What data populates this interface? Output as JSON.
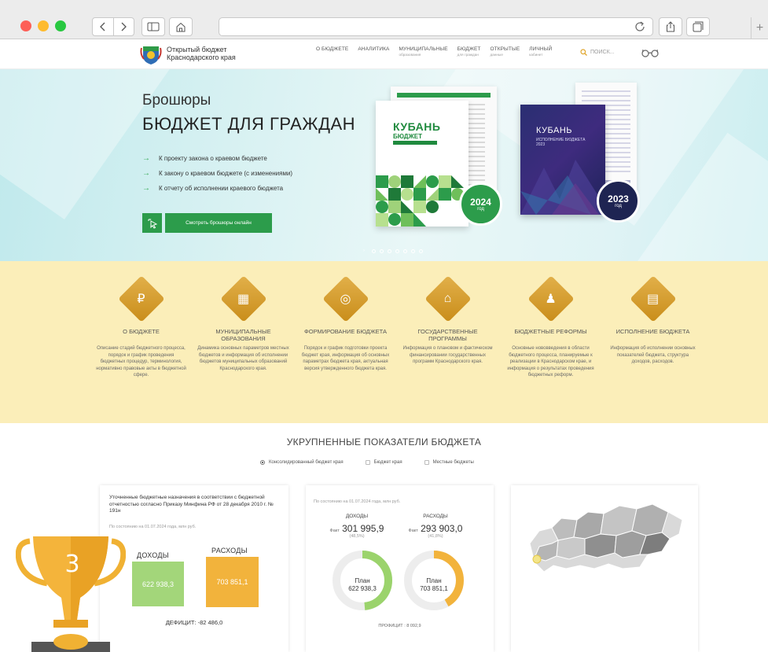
{
  "site": {
    "brand_line1": "Открытый бюджет",
    "brand_line2": "Краснодарского края",
    "nav": [
      {
        "label": "О БЮДЖЕТЕ",
        "sub": ""
      },
      {
        "label": "АНАЛИТИКА",
        "sub": ""
      },
      {
        "label": "МУНИЦИПАЛЬНЫЕ",
        "sub": "образования"
      },
      {
        "label": "БЮДЖЕТ",
        "sub": "для граждан"
      },
      {
        "label": "ОТКРЫТЫЕ",
        "sub": "данные"
      },
      {
        "label": "ЛИЧНЫЙ",
        "sub": "кабинет"
      }
    ],
    "search_placeholder": "ПОИСК..."
  },
  "hero": {
    "subtitle": "Брошюры",
    "title": "БЮДЖЕТ ДЛЯ ГРАЖДАН",
    "links": [
      "К проекту закона о краевом бюджете",
      "К закону о краевом бюджете (с изменениями)",
      "К отчету об исполнении краевого бюджета"
    ],
    "cta_label": "Смотреть брошюры онлайн",
    "brochure_2024": {
      "title": "КУБАНЬ",
      "subtitle": "БЮДЖЕТ",
      "year": "2024",
      "year_word": "год"
    },
    "brochure_2023": {
      "title": "КУБАНЬ",
      "subtitle": "ИСПОЛНЕНИЕ БЮДЖЕТА 2023",
      "year": "2023",
      "year_word": "год"
    }
  },
  "features": [
    {
      "icon": "money-bag-icon",
      "glyph": "₽",
      "title": "О БЮДЖЕТЕ",
      "text": "Описание стадий бюджетного процесса, порядок и график проведения бюджетных процедур, терминология, нормативно правовые акты в бюджетной сфере."
    },
    {
      "icon": "buildings-icon",
      "glyph": "▦",
      "title": "МУНИЦИПАЛЬНЫЕ ОБРАЗОВАНИЯ",
      "text": "Динамика основных параметров местных бюджетов и информация об исполнении бюджетов муниципальных образований Краснодарского края."
    },
    {
      "icon": "coins-icon",
      "glyph": "◎",
      "title": "ФОРМИРОВАНИЕ БЮДЖЕТА",
      "text": "Порядок и график подготовки проекта бюджет края, информация об основных параметрах бюджета края, актуальная версия утвержденного бюджета края."
    },
    {
      "icon": "government-building-icon",
      "glyph": "⌂",
      "title": "ГОСУДАРСТВЕННЫЕ ПРОГРАММЫ",
      "text": "Информация о плановом и фактическом финансировании государственных программ Краснодарского края."
    },
    {
      "icon": "people-icon",
      "glyph": "♟",
      "title": "БЮДЖЕТНЫЕ РЕФОРМЫ",
      "text": "Основные нововведения в области бюджетного процесса, планируемые к реализации в Краснодарском крае, и информация о результатах проведения бюджетных реформ."
    },
    {
      "icon": "chart-icon",
      "glyph": "▤",
      "title": "ИСПОЛНЕНИЕ БЮДЖЕТА",
      "text": "Информация об исполнении основных показателей бюджета, структура доходов, расходов."
    }
  ],
  "indicators": {
    "title": "УКРУПНЕННЫЕ ПОКАЗАТЕЛИ БЮДЖЕТА",
    "options": [
      "Консолидированный бюджет края",
      "Бюджет края",
      "Местные бюджеты"
    ],
    "card1": {
      "note": "Уточненные бюджетные назначения в соответствии с бюджетной отчетностью согласно Приказу Минфина РФ от 28 декабря 2010 г. № 191н",
      "state": "По состоянию на 01.07.2024 года, млн руб.",
      "income_label": "ДОХОДЫ",
      "income_value": "622 938,3",
      "expense_label": "РАСХОДЫ",
      "expense_value": "703 851,1",
      "deficit": "ДЕФИЦИТ: -82 486,0",
      "income_color": "#a3d67a",
      "expense_color": "#f2b33c"
    },
    "card2": {
      "state": "По состоянию на 01.07.2024 года, млн руб.",
      "income_label": "ДОХОДЫ",
      "income_fact_prefix": "Факт",
      "income_fact": "301 995,9",
      "income_pct": "(48,5%)",
      "expense_label": "РАСХОДЫ",
      "expense_fact_prefix": "Факт",
      "expense_fact": "293 903,0",
      "expense_pct": "(41,8%)",
      "plan_word": "План",
      "income_plan": "622 938,3",
      "expense_plan": "703 851,1",
      "income_fraction": 0.485,
      "expense_fraction": 0.418,
      "profit": "ПРОФИЦИТ : 8 092,9"
    }
  },
  "trophy": {
    "place": "3"
  }
}
